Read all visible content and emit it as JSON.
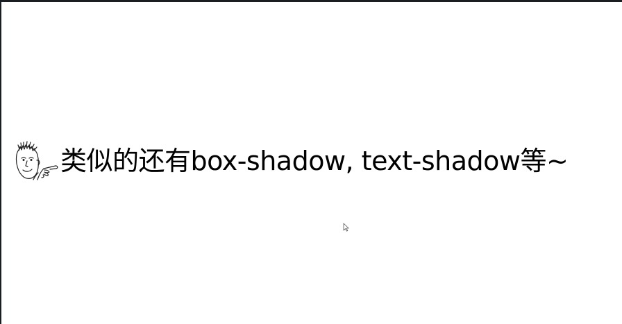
{
  "slide": {
    "text": "类似的还有box-shadow, text-shadow等~",
    "mascot_icon": "pointing-face-icon",
    "cursor_icon": "mouse-pointer-icon"
  },
  "colors": {
    "background": "#ffffff",
    "text": "#000000",
    "window_border": "#1a1e22"
  }
}
